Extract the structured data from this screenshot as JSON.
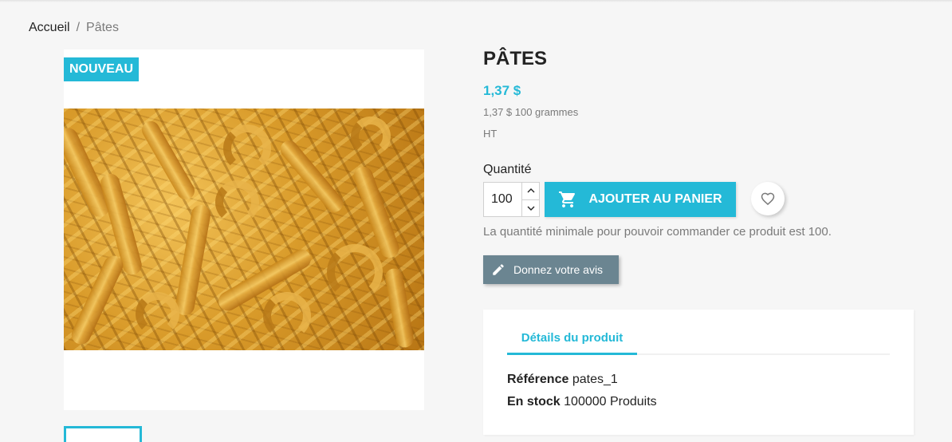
{
  "breadcrumb": {
    "home": "Accueil",
    "separator": "/",
    "current": "Pâtes"
  },
  "product": {
    "badge": "NOUVEAU",
    "title": "PÂTES",
    "price": "1,37 $",
    "unit_price": "1,37 $ 100 grammes",
    "tax_label": "HT",
    "quantity_label": "Quantité",
    "quantity_value": "100",
    "add_to_cart_label": "AJOUTER AU PANIER",
    "min_quantity_note": "La quantité minimale pour pouvoir commander ce produit est 100.",
    "review_button_label": "Donnez votre avis"
  },
  "details": {
    "tab_label": "Détails du produit",
    "reference_key": "Référence",
    "reference_value": "pates_1",
    "stock_key": "En stock",
    "stock_value": "100000 Produits"
  },
  "icons": {
    "cart": "shopping-cart-icon",
    "wishlist": "heart-icon",
    "review": "pencil-icon",
    "qty_up": "chevron-up-icon",
    "qty_down": "chevron-down-icon"
  },
  "colors": {
    "accent": "#24b9d7",
    "review_button": "#6b8591",
    "background": "#f6f6f6"
  }
}
